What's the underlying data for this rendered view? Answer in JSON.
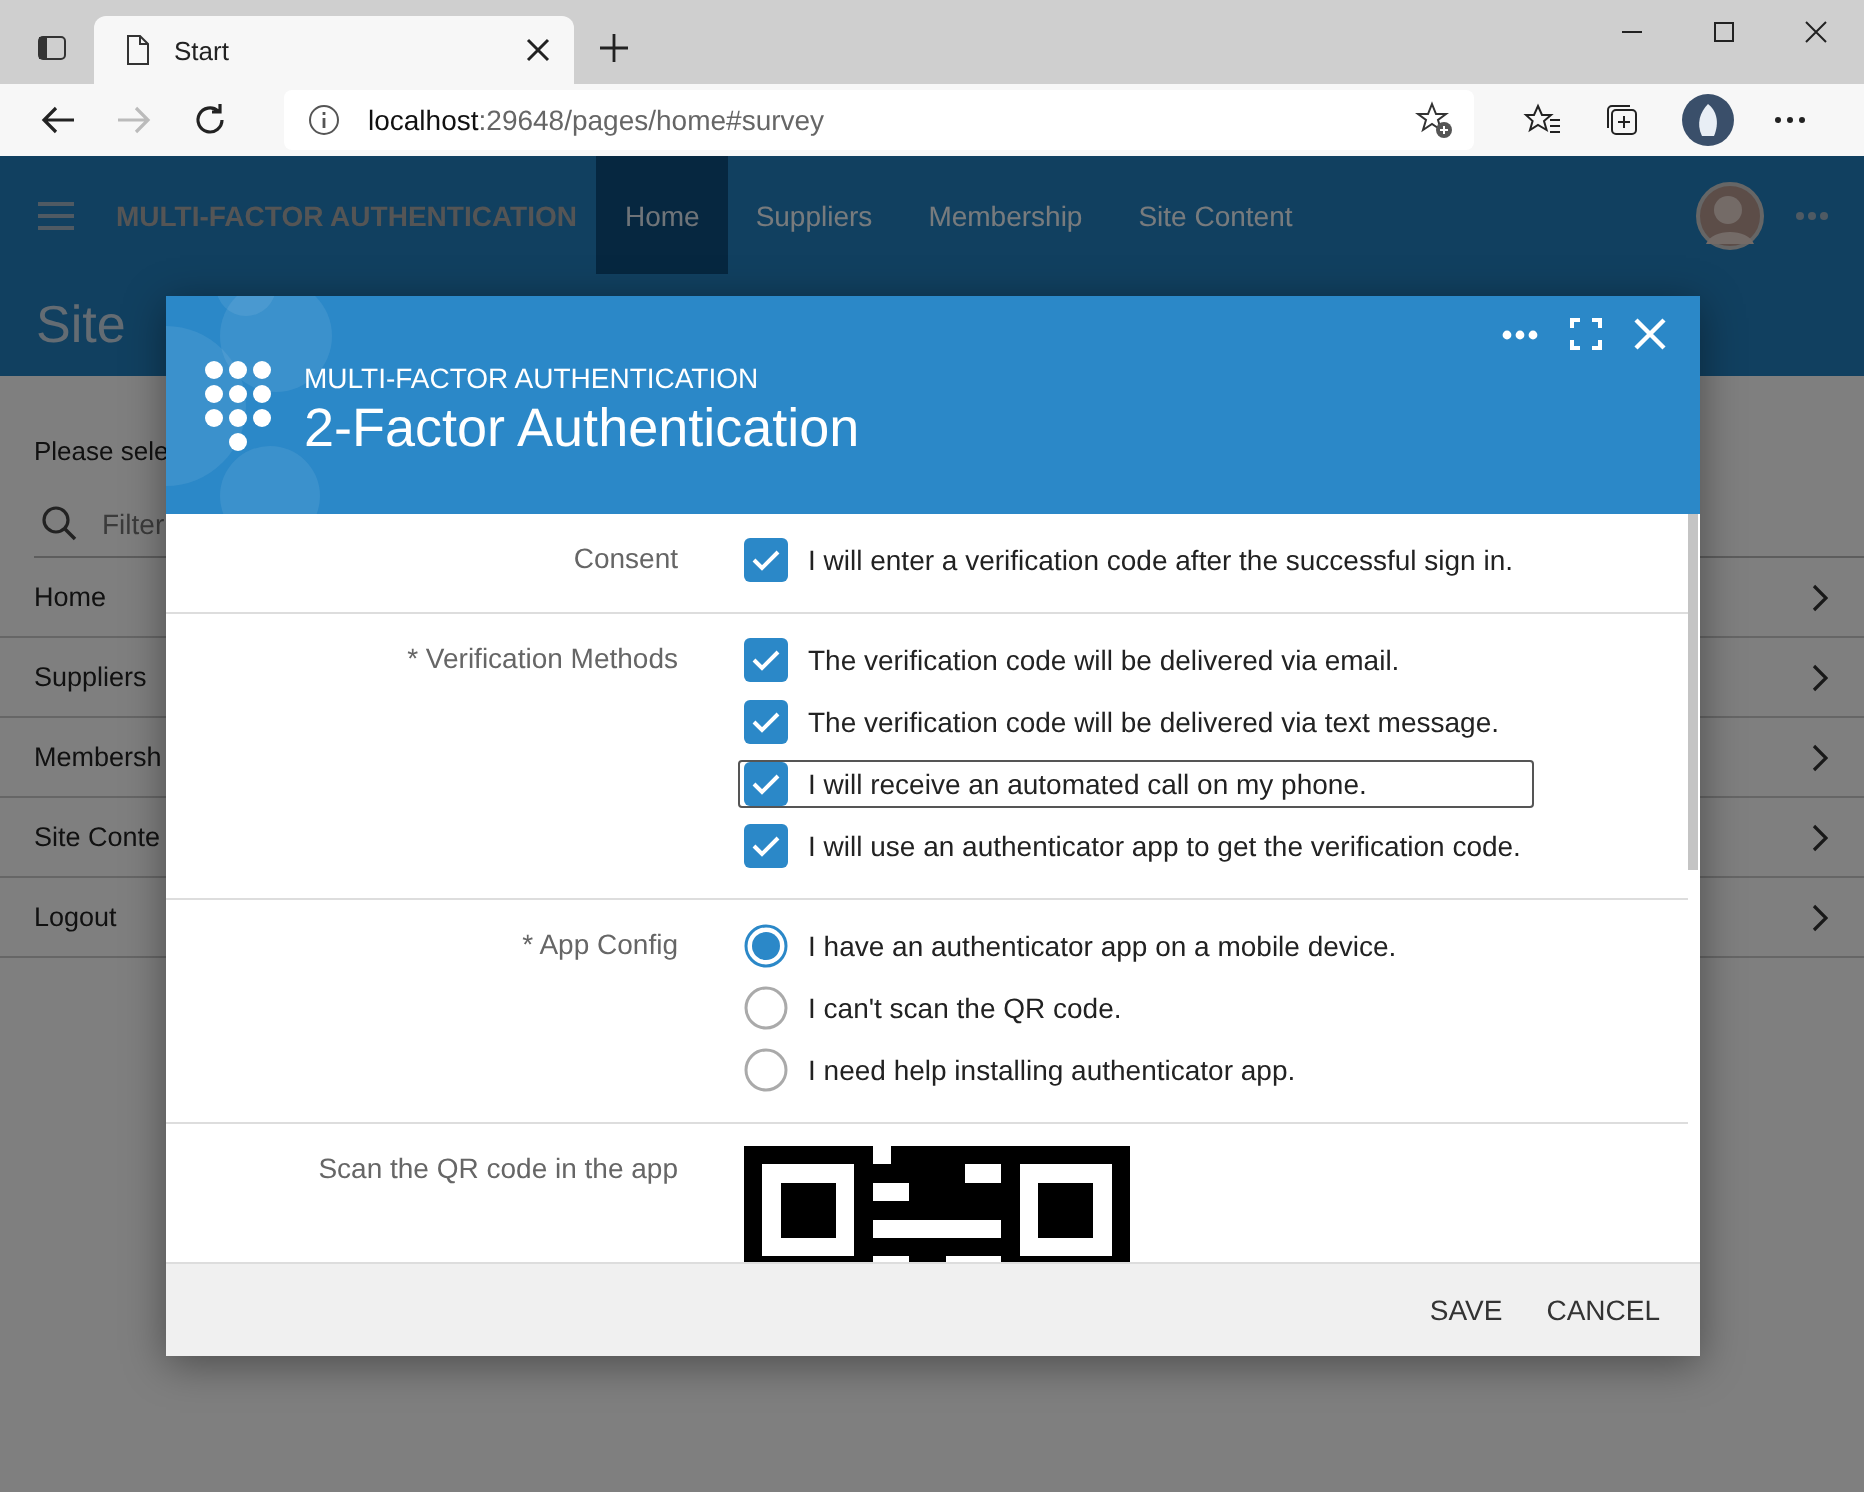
{
  "browser": {
    "tabs": [
      {
        "title": "Start",
        "selected": true
      }
    ],
    "address": {
      "host": "localhost",
      "rest": ":29648/pages/home#survey"
    }
  },
  "app": {
    "brand": "MULTI-FACTOR AUTHENTICATION",
    "nav": [
      {
        "label": "Home",
        "selected": true
      },
      {
        "label": "Suppliers",
        "selected": false
      },
      {
        "label": "Membership",
        "selected": false
      },
      {
        "label": "Site Content",
        "selected": false
      }
    ],
    "page_title": "Site",
    "prompt": "Please sele",
    "filter_placeholder": "Filter",
    "menu": [
      "Home",
      "Suppliers",
      "Membersh",
      "Site Conte",
      "Logout"
    ]
  },
  "modal": {
    "subtitle": "MULTI-FACTOR AUTHENTICATION",
    "title": "2-Factor Authentication",
    "sections": [
      {
        "label": "Consent",
        "kind": "checkbox",
        "options": [
          {
            "label": "I will enter a verification code after the successful sign in.",
            "checked": true,
            "focused": false
          }
        ]
      },
      {
        "label": "* Verification Methods",
        "kind": "checkbox",
        "options": [
          {
            "label": "The verification code will be delivered via email.",
            "checked": true,
            "focused": false
          },
          {
            "label": "The verification code will be delivered via text message.",
            "checked": true,
            "focused": false
          },
          {
            "label": "I will receive an automated call on my phone.",
            "checked": true,
            "focused": true
          },
          {
            "label": "I will use an authenticator app to get the verification code.",
            "checked": true,
            "focused": false
          }
        ]
      },
      {
        "label": "* App Config",
        "kind": "radio",
        "options": [
          {
            "label": "I have an authenticator app on a mobile device.",
            "selected": true
          },
          {
            "label": "I can't scan the QR code.",
            "selected": false
          },
          {
            "label": "I need help installing authenticator app.",
            "selected": false
          }
        ]
      },
      {
        "label": "Scan the QR code in the app",
        "kind": "qr"
      }
    ],
    "buttons": [
      "SAVE",
      "CANCEL"
    ]
  }
}
